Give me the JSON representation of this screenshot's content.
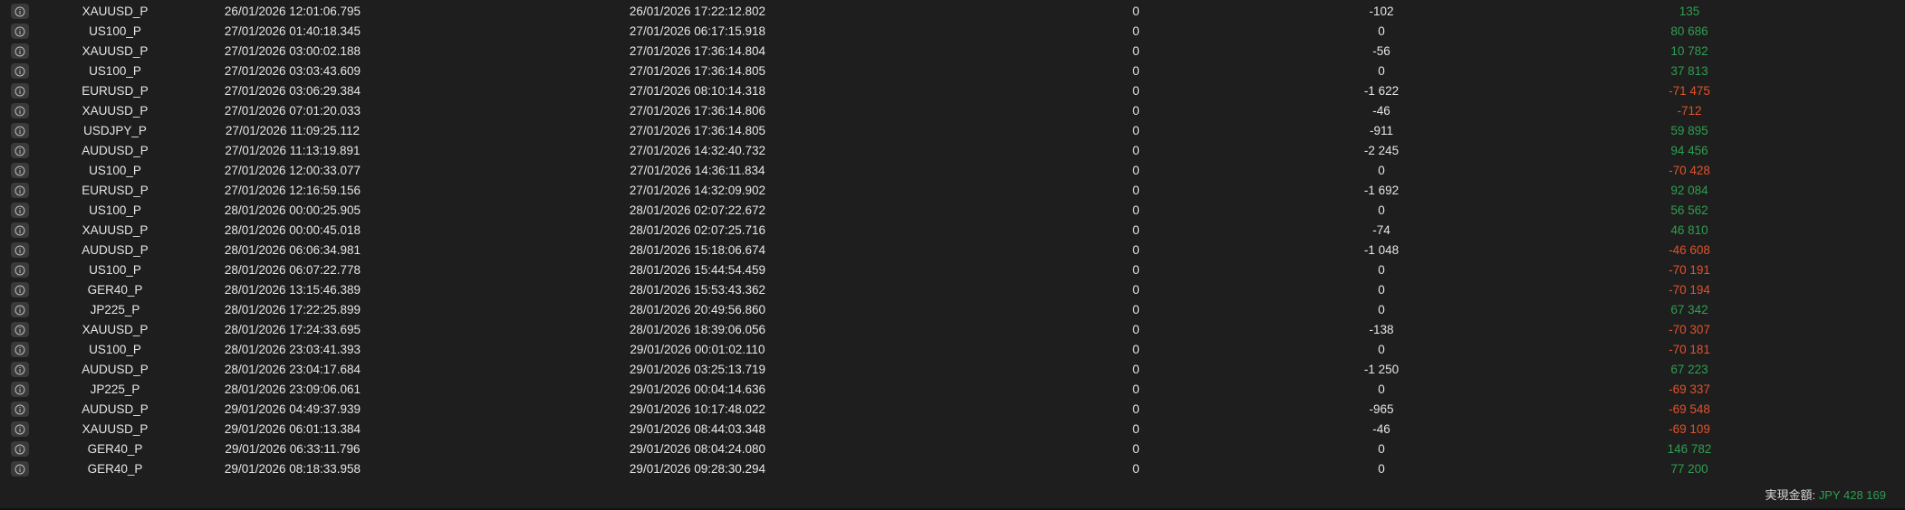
{
  "colors": {
    "background": "#1e1e1e",
    "text": "#e6e6e6",
    "positive": "#2e9e4f",
    "negative": "#e0522a",
    "info_button_bg": "#3a3a3a"
  },
  "row_icon": "info-circle-icon",
  "rows": [
    {
      "symbol": "XAUUSD_P",
      "open_time": "26/01/2026 12:01:06.795",
      "close_time": "26/01/2026 17:22:12.802",
      "swap": "0",
      "commission": "-102",
      "profit": "135",
      "profit_sign": "pos"
    },
    {
      "symbol": "US100_P",
      "open_time": "27/01/2026 01:40:18.345",
      "close_time": "27/01/2026 06:17:15.918",
      "swap": "0",
      "commission": "0",
      "profit": "80 686",
      "profit_sign": "pos"
    },
    {
      "symbol": "XAUUSD_P",
      "open_time": "27/01/2026 03:00:02.188",
      "close_time": "27/01/2026 17:36:14.804",
      "swap": "0",
      "commission": "-56",
      "profit": "10 782",
      "profit_sign": "pos"
    },
    {
      "symbol": "US100_P",
      "open_time": "27/01/2026 03:03:43.609",
      "close_time": "27/01/2026 17:36:14.805",
      "swap": "0",
      "commission": "0",
      "profit": "37 813",
      "profit_sign": "pos"
    },
    {
      "symbol": "EURUSD_P",
      "open_time": "27/01/2026 03:06:29.384",
      "close_time": "27/01/2026 08:10:14.318",
      "swap": "0",
      "commission": "-1 622",
      "profit": "-71 475",
      "profit_sign": "neg"
    },
    {
      "symbol": "XAUUSD_P",
      "open_time": "27/01/2026 07:01:20.033",
      "close_time": "27/01/2026 17:36:14.806",
      "swap": "0",
      "commission": "-46",
      "profit": "-712",
      "profit_sign": "neg"
    },
    {
      "symbol": "USDJPY_P",
      "open_time": "27/01/2026 11:09:25.112",
      "close_time": "27/01/2026 17:36:14.805",
      "swap": "0",
      "commission": "-911",
      "profit": "59 895",
      "profit_sign": "pos"
    },
    {
      "symbol": "AUDUSD_P",
      "open_time": "27/01/2026 11:13:19.891",
      "close_time": "27/01/2026 14:32:40.732",
      "swap": "0",
      "commission": "-2 245",
      "profit": "94 456",
      "profit_sign": "pos"
    },
    {
      "symbol": "US100_P",
      "open_time": "27/01/2026 12:00:33.077",
      "close_time": "27/01/2026 14:36:11.834",
      "swap": "0",
      "commission": "0",
      "profit": "-70 428",
      "profit_sign": "neg"
    },
    {
      "symbol": "EURUSD_P",
      "open_time": "27/01/2026 12:16:59.156",
      "close_time": "27/01/2026 14:32:09.902",
      "swap": "0",
      "commission": "-1 692",
      "profit": "92 084",
      "profit_sign": "pos"
    },
    {
      "symbol": "US100_P",
      "open_time": "28/01/2026 00:00:25.905",
      "close_time": "28/01/2026 02:07:22.672",
      "swap": "0",
      "commission": "0",
      "profit": "56 562",
      "profit_sign": "pos"
    },
    {
      "symbol": "XAUUSD_P",
      "open_time": "28/01/2026 00:00:45.018",
      "close_time": "28/01/2026 02:07:25.716",
      "swap": "0",
      "commission": "-74",
      "profit": "46 810",
      "profit_sign": "pos"
    },
    {
      "symbol": "AUDUSD_P",
      "open_time": "28/01/2026 06:06:34.981",
      "close_time": "28/01/2026 15:18:06.674",
      "swap": "0",
      "commission": "-1 048",
      "profit": "-46 608",
      "profit_sign": "neg"
    },
    {
      "symbol": "US100_P",
      "open_time": "28/01/2026 06:07:22.778",
      "close_time": "28/01/2026 15:44:54.459",
      "swap": "0",
      "commission": "0",
      "profit": "-70 191",
      "profit_sign": "neg"
    },
    {
      "symbol": "GER40_P",
      "open_time": "28/01/2026 13:15:46.389",
      "close_time": "28/01/2026 15:53:43.362",
      "swap": "0",
      "commission": "0",
      "profit": "-70 194",
      "profit_sign": "neg"
    },
    {
      "symbol": "JP225_P",
      "open_time": "28/01/2026 17:22:25.899",
      "close_time": "28/01/2026 20:49:56.860",
      "swap": "0",
      "commission": "0",
      "profit": "67 342",
      "profit_sign": "pos"
    },
    {
      "symbol": "XAUUSD_P",
      "open_time": "28/01/2026 17:24:33.695",
      "close_time": "28/01/2026 18:39:06.056",
      "swap": "0",
      "commission": "-138",
      "profit": "-70 307",
      "profit_sign": "neg"
    },
    {
      "symbol": "US100_P",
      "open_time": "28/01/2026 23:03:41.393",
      "close_time": "29/01/2026 00:01:02.110",
      "swap": "0",
      "commission": "0",
      "profit": "-70 181",
      "profit_sign": "neg"
    },
    {
      "symbol": "AUDUSD_P",
      "open_time": "28/01/2026 23:04:17.684",
      "close_time": "29/01/2026 03:25:13.719",
      "swap": "0",
      "commission": "-1 250",
      "profit": "67 223",
      "profit_sign": "pos"
    },
    {
      "symbol": "JP225_P",
      "open_time": "28/01/2026 23:09:06.061",
      "close_time": "29/01/2026 00:04:14.636",
      "swap": "0",
      "commission": "0",
      "profit": "-69 337",
      "profit_sign": "neg"
    },
    {
      "symbol": "AUDUSD_P",
      "open_time": "29/01/2026 04:49:37.939",
      "close_time": "29/01/2026 10:17:48.022",
      "swap": "0",
      "commission": "-965",
      "profit": "-69 548",
      "profit_sign": "neg"
    },
    {
      "symbol": "XAUUSD_P",
      "open_time": "29/01/2026 06:01:13.384",
      "close_time": "29/01/2026 08:44:03.348",
      "swap": "0",
      "commission": "-46",
      "profit": "-69 109",
      "profit_sign": "neg"
    },
    {
      "symbol": "GER40_P",
      "open_time": "29/01/2026 06:33:11.796",
      "close_time": "29/01/2026 08:04:24.080",
      "swap": "0",
      "commission": "0",
      "profit": "146 782",
      "profit_sign": "pos"
    },
    {
      "symbol": "GER40_P",
      "open_time": "29/01/2026 08:18:33.958",
      "close_time": "29/01/2026 09:28:30.294",
      "swap": "0",
      "commission": "0",
      "profit": "77 200",
      "profit_sign": "pos"
    }
  ],
  "summary": {
    "label": "実現金額:",
    "amount": "JPY 428 169"
  }
}
